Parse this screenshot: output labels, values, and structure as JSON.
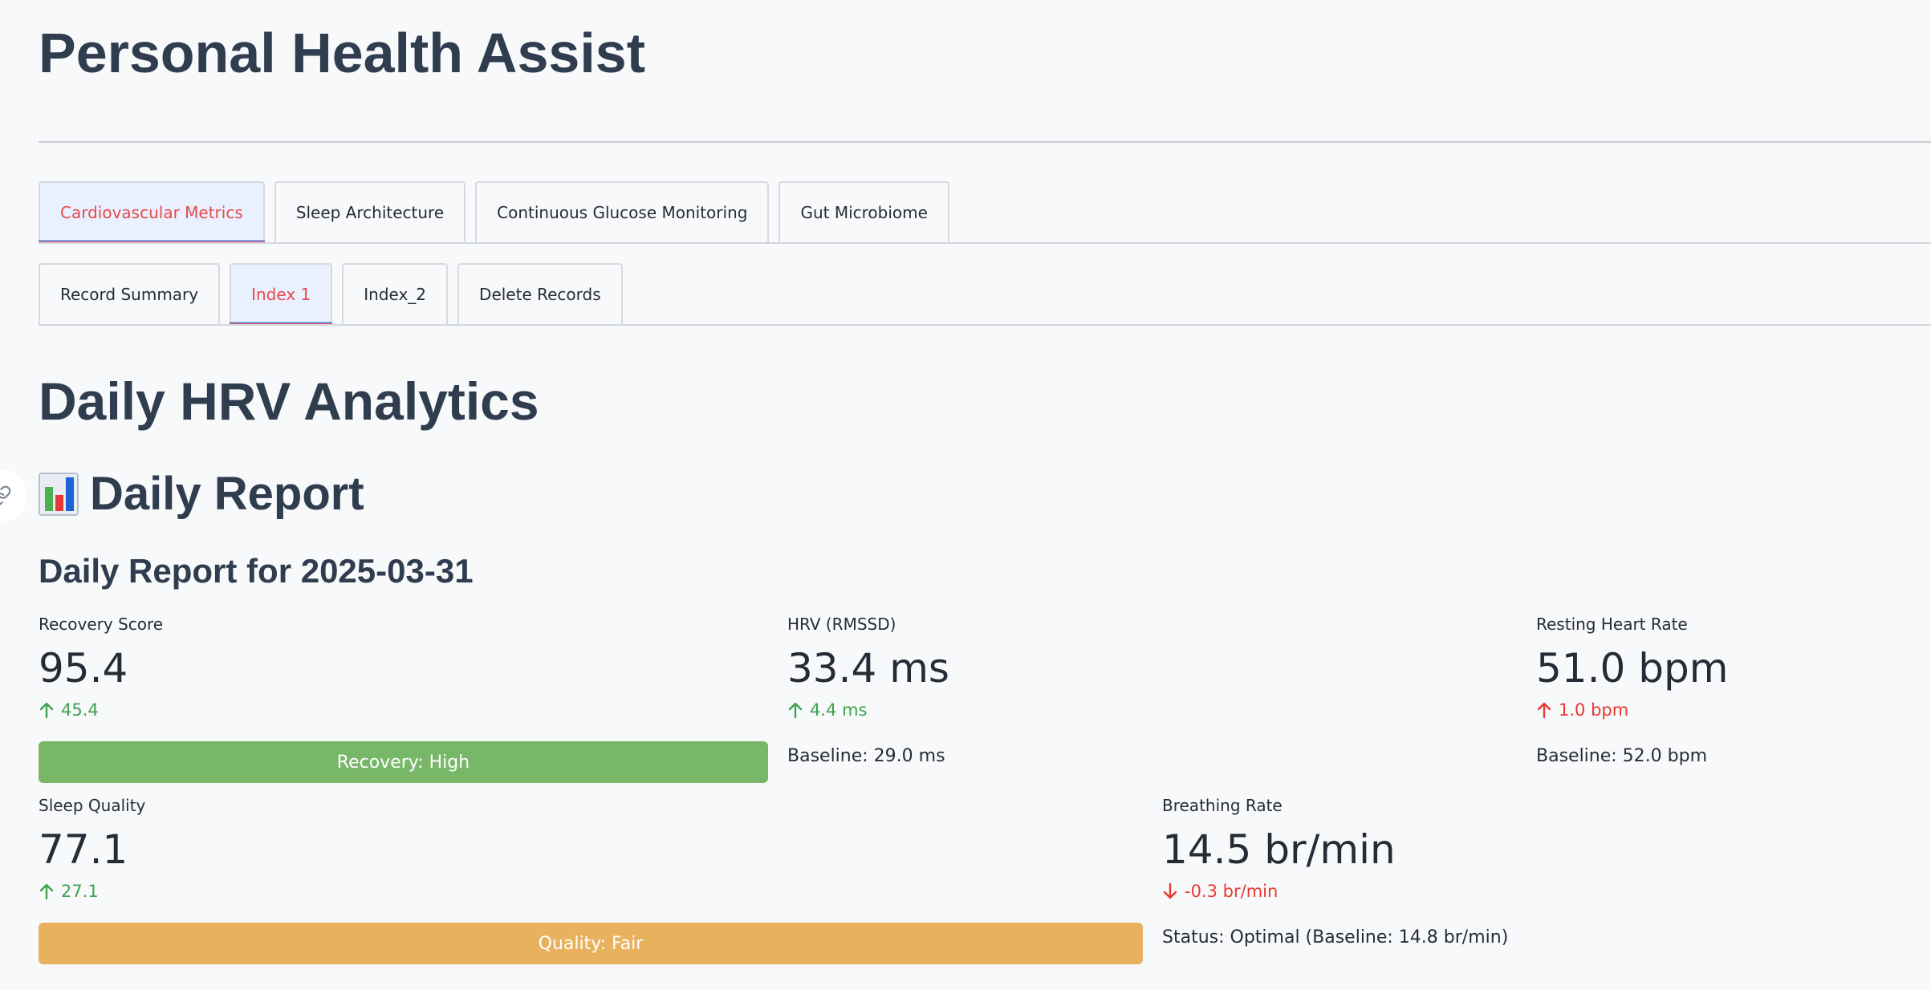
{
  "app": {
    "title": "Personal Health Assist"
  },
  "primary_tabs": [
    {
      "label": "Cardiovascular Metrics",
      "active": true
    },
    {
      "label": "Sleep Architecture",
      "active": false
    },
    {
      "label": "Continuous Glucose Monitoring",
      "active": false
    },
    {
      "label": "Gut Microbiome",
      "active": false
    }
  ],
  "secondary_tabs": [
    {
      "label": "Record Summary",
      "active": false
    },
    {
      "label": "Index 1",
      "active": true
    },
    {
      "label": "Index_2",
      "active": false
    },
    {
      "label": "Delete Records",
      "active": false
    }
  ],
  "page": {
    "heading": "Daily HRV Analytics",
    "section_heading": "Daily Report",
    "section_icon": "bar-chart-emoji",
    "report_title": "Daily Report for 2025-03-31"
  },
  "metrics": {
    "recovery": {
      "label": "Recovery Score",
      "value": "95.4",
      "delta": "45.4",
      "direction": "up"
    },
    "hrv": {
      "label": "HRV (RMSSD)",
      "value": "33.4 ms",
      "delta": "4.4 ms",
      "direction": "up",
      "note": "Baseline: 29.0 ms"
    },
    "rhr": {
      "label": "Resting Heart Rate",
      "value": "51.0 bpm",
      "delta": "1.0 bpm",
      "direction": "up",
      "note": "Baseline: 52.0 bpm"
    },
    "sleep": {
      "label": "Sleep Quality",
      "value": "77.1",
      "delta": "27.1",
      "direction": "up"
    },
    "breathing": {
      "label": "Breathing Rate",
      "value": "14.5 br/min",
      "delta": "-0.3 br/min",
      "direction": "down",
      "note": "Status: Optimal (Baseline: 14.8 br/min)"
    }
  },
  "status_bars": {
    "recovery": {
      "label": "Recovery: High",
      "color": "#77b767"
    },
    "quality": {
      "label": "Quality: Fair",
      "color": "#e8b15e"
    }
  },
  "colors": {
    "delta_up": "#3fa34d",
    "delta_down": "#e8392f",
    "tab_active_text": "#e8494b",
    "heading": "#2f3d4f"
  }
}
